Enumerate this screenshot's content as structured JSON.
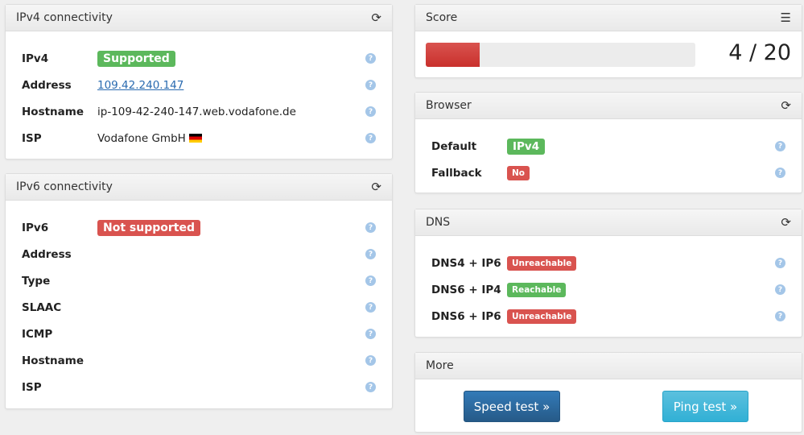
{
  "ipv4": {
    "title": "IPv4 connectivity",
    "rows": [
      {
        "label": "IPv4",
        "badge": "Supported"
      },
      {
        "label": "Address",
        "value": "109.42.240.147"
      },
      {
        "label": "Hostname",
        "value": "ip-109-42-240-147.web.vodafone.de"
      },
      {
        "label": "ISP",
        "value": "Vodafone GmbH"
      }
    ]
  },
  "ipv6": {
    "title": "IPv6 connectivity",
    "rows": [
      {
        "label": "IPv6",
        "badge": "Not supported"
      },
      {
        "label": "Address"
      },
      {
        "label": "Type"
      },
      {
        "label": "SLAAC"
      },
      {
        "label": "ICMP"
      },
      {
        "label": "Hostname"
      },
      {
        "label": "ISP"
      }
    ]
  },
  "score": {
    "title": "Score",
    "value": 4,
    "max": 20,
    "text": "4 / 20"
  },
  "browser": {
    "title": "Browser",
    "rows": [
      {
        "label": "Default",
        "badge": "IPv4"
      },
      {
        "label": "Fallback",
        "badge": "No"
      }
    ]
  },
  "dns": {
    "title": "DNS",
    "rows": [
      {
        "label": "DNS4 + IP6",
        "badge": "Unreachable"
      },
      {
        "label": "DNS6 + IP4",
        "badge": "Reachable"
      },
      {
        "label": "DNS6 + IP6",
        "badge": "Unreachable"
      }
    ]
  },
  "more": {
    "title": "More",
    "speed": "Speed test »",
    "ping": "Ping test »"
  },
  "help": "?"
}
